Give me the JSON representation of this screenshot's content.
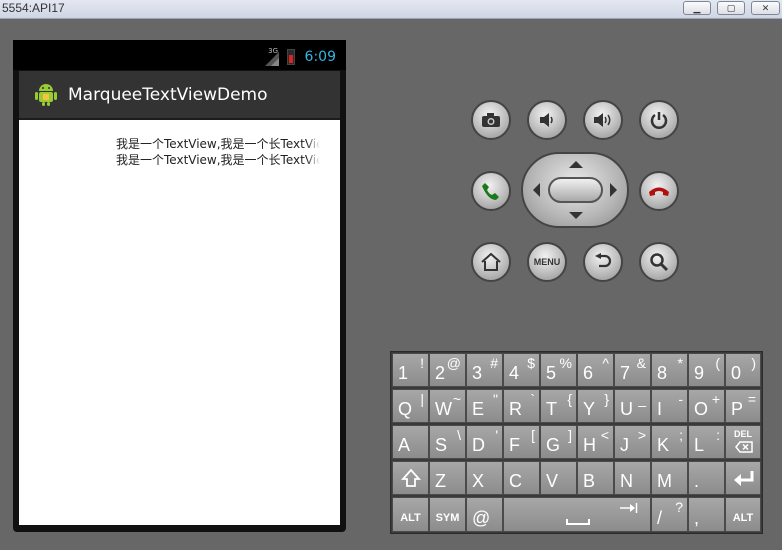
{
  "window": {
    "title": "5554:API17"
  },
  "status_bar": {
    "time": "6:09",
    "network": "3G"
  },
  "action_bar": {
    "title": "MarqueeTextViewDemo"
  },
  "content": {
    "lines": [
      "我是一个TextView,我是一个长TextView",
      "我是一个TextView,我是一个长TextView"
    ]
  },
  "hardware": {
    "menu_label": "MENU"
  },
  "keyboard": {
    "rows": [
      [
        {
          "k": "1",
          "a": "!"
        },
        {
          "k": "2",
          "a": "@"
        },
        {
          "k": "3",
          "a": "#"
        },
        {
          "k": "4",
          "a": "$"
        },
        {
          "k": "5",
          "a": "%"
        },
        {
          "k": "6",
          "a": "^"
        },
        {
          "k": "7",
          "a": "&"
        },
        {
          "k": "8",
          "a": "*"
        },
        {
          "k": "9",
          "a": "("
        },
        {
          "k": "0",
          "a": ")"
        }
      ],
      [
        {
          "k": "Q",
          "a": "|"
        },
        {
          "k": "W",
          "a": "~"
        },
        {
          "k": "E",
          "a": "\""
        },
        {
          "k": "R",
          "a": "`"
        },
        {
          "k": "T",
          "a": "{"
        },
        {
          "k": "Y",
          "a": "}"
        },
        {
          "k": "U",
          "a": "_"
        },
        {
          "k": "I",
          "a": "-"
        },
        {
          "k": "O",
          "a": "+"
        },
        {
          "k": "P",
          "a": "="
        }
      ],
      [
        {
          "k": "A",
          "a": ""
        },
        {
          "k": "S",
          "a": "\\"
        },
        {
          "k": "D",
          "a": "'"
        },
        {
          "k": "F",
          "a": "["
        },
        {
          "k": "G",
          "a": "]"
        },
        {
          "k": "H",
          "a": "<"
        },
        {
          "k": "J",
          "a": ">"
        },
        {
          "k": "K",
          "a": ";"
        },
        {
          "k": "L",
          "a": ":"
        },
        {
          "k": "DEL",
          "a": ""
        }
      ],
      [
        {
          "k": "⇧",
          "a": ""
        },
        {
          "k": "Z",
          "a": ""
        },
        {
          "k": "X",
          "a": ""
        },
        {
          "k": "C",
          "a": ""
        },
        {
          "k": "V",
          "a": ""
        },
        {
          "k": "B",
          "a": ""
        },
        {
          "k": "N",
          "a": ""
        },
        {
          "k": "M",
          "a": ""
        },
        {
          "k": ".",
          "a": ""
        },
        {
          "k": "↵",
          "a": ""
        }
      ]
    ],
    "bottom": {
      "alt_left": "ALT",
      "sym": "SYM",
      "at": "@",
      "slash": "/",
      "slash_alt": "?",
      "comma": ",",
      "alt_right": "ALT"
    }
  }
}
